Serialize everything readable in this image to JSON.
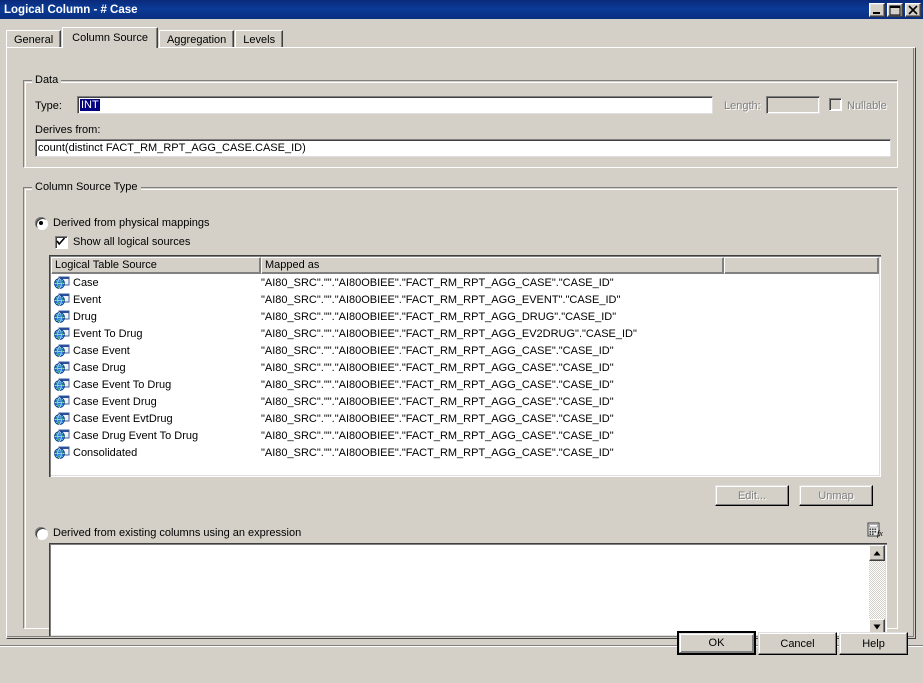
{
  "window": {
    "title": "Logical Column - # Case",
    "controls": [
      {
        "name": "minimize",
        "glyph": "minimize-icon"
      },
      {
        "name": "maximize",
        "glyph": "maximize-icon"
      },
      {
        "name": "close",
        "glyph": "close-icon"
      }
    ]
  },
  "tabs": [
    {
      "label": "General",
      "active": false
    },
    {
      "label": "Column Source",
      "active": true
    },
    {
      "label": "Aggregation",
      "active": false
    },
    {
      "label": "Levels",
      "active": false
    }
  ],
  "data_group": {
    "title": "Data",
    "type_label": "Type:",
    "type_value": "INT",
    "length_label": "Length:",
    "length_value": "",
    "nullable_label": "Nullable",
    "nullable_checked": false,
    "derives_from_label": "Derives from:",
    "derives_from_value": "count(distinct FACT_RM_RPT_AGG_CASE.CASE_ID)"
  },
  "column_source_group": {
    "title": "Column Source Type",
    "radio_physical_label": "Derived from physical mappings",
    "radio_physical_selected": true,
    "show_all_logical_sources_label": "Show all logical sources",
    "show_all_logical_sources_checked": true,
    "radio_expression_label": "Derived from existing columns using an expression",
    "radio_expression_selected": false,
    "expression_value": "",
    "edit_button": "Edit...",
    "unmap_button": "Unmap",
    "fx_button_icon": "expression-builder-icon"
  },
  "table": {
    "columns": [
      "Logical Table Source",
      "Mapped as",
      ""
    ],
    "rows": [
      {
        "source": "Case",
        "mapped_as": "\"AI80_SRC\".\"\".\"AI80OBIEE\".\"FACT_RM_RPT_AGG_CASE\".\"CASE_ID\"",
        "icon": "logical-table-source-icon"
      },
      {
        "source": "Event",
        "mapped_as": "\"AI80_SRC\".\"\".\"AI80OBIEE\".\"FACT_RM_RPT_AGG_EVENT\".\"CASE_ID\"",
        "icon": "logical-table-source-icon"
      },
      {
        "source": "Drug",
        "mapped_as": "\"AI80_SRC\".\"\".\"AI80OBIEE\".\"FACT_RM_RPT_AGG_DRUG\".\"CASE_ID\"",
        "icon": "logical-table-source-icon"
      },
      {
        "source": "Event To Drug",
        "mapped_as": "\"AI80_SRC\".\"\".\"AI80OBIEE\".\"FACT_RM_RPT_AGG_EV2DRUG\".\"CASE_ID\"",
        "icon": "logical-table-source-icon"
      },
      {
        "source": "Case Event",
        "mapped_as": "\"AI80_SRC\".\"\".\"AI80OBIEE\".\"FACT_RM_RPT_AGG_CASE\".\"CASE_ID\"",
        "icon": "logical-table-source-icon"
      },
      {
        "source": "Case Drug",
        "mapped_as": "\"AI80_SRC\".\"\".\"AI80OBIEE\".\"FACT_RM_RPT_AGG_CASE\".\"CASE_ID\"",
        "icon": "logical-table-source-icon"
      },
      {
        "source": "Case Event To Drug",
        "mapped_as": "\"AI80_SRC\".\"\".\"AI80OBIEE\".\"FACT_RM_RPT_AGG_CASE\".\"CASE_ID\"",
        "icon": "logical-table-source-icon"
      },
      {
        "source": "Case Event Drug",
        "mapped_as": "\"AI80_SRC\".\"\".\"AI80OBIEE\".\"FACT_RM_RPT_AGG_CASE\".\"CASE_ID\"",
        "icon": "logical-table-source-icon"
      },
      {
        "source": "Case Event EvtDrug",
        "mapped_as": "\"AI80_SRC\".\"\".\"AI80OBIEE\".\"FACT_RM_RPT_AGG_CASE\".\"CASE_ID\"",
        "icon": "logical-table-source-icon"
      },
      {
        "source": "Case Drug Event To Drug",
        "mapped_as": "\"AI80_SRC\".\"\".\"AI80OBIEE\".\"FACT_RM_RPT_AGG_CASE\".\"CASE_ID\"",
        "icon": "logical-table-source-icon"
      },
      {
        "source": "Consolidated",
        "mapped_as": "\"AI80_SRC\".\"\".\"AI80OBIEE\".\"FACT_RM_RPT_AGG_CASE\".\"CASE_ID\"",
        "icon": "logical-table-source-icon"
      }
    ]
  },
  "footer": {
    "ok": "OK",
    "cancel": "Cancel",
    "help": "Help"
  },
  "colors": {
    "titlebar": "#0b3b96",
    "face": "#d4d0c8",
    "selection": "#000080",
    "disabled_text": "#808080"
  }
}
